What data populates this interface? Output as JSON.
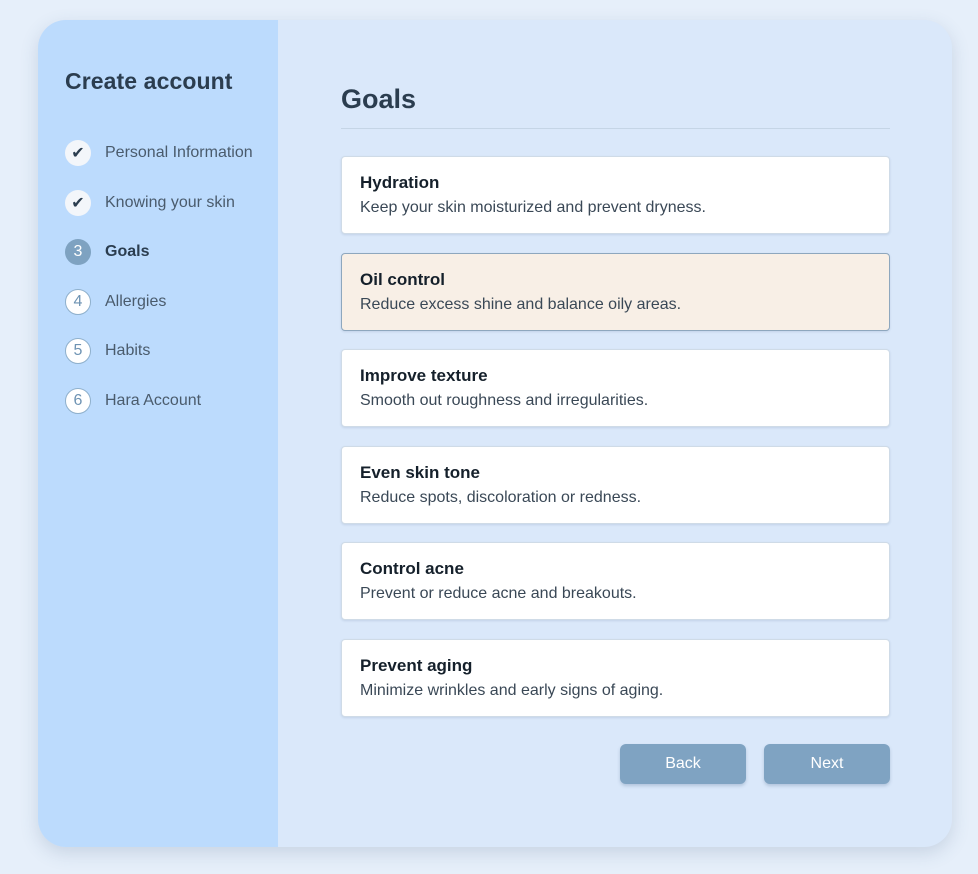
{
  "sidebar": {
    "title": "Create account",
    "steps": [
      {
        "marker": "✔",
        "label": "Personal Information",
        "state": "done"
      },
      {
        "marker": "✔",
        "label": "Knowing your skin",
        "state": "done"
      },
      {
        "marker": "3",
        "label": "Goals",
        "state": "current"
      },
      {
        "marker": "4",
        "label": "Allergies",
        "state": "upcoming"
      },
      {
        "marker": "5",
        "label": "Habits",
        "state": "upcoming"
      },
      {
        "marker": "6",
        "label": "Hara Account",
        "state": "upcoming"
      }
    ]
  },
  "main": {
    "title": "Goals",
    "goals": [
      {
        "title": "Hydration",
        "description": "Keep your skin moisturized and prevent dryness.",
        "selected": false
      },
      {
        "title": "Oil control",
        "description": "Reduce excess shine and balance oily areas.",
        "selected": true
      },
      {
        "title": "Improve texture",
        "description": "Smooth out roughness and irregularities.",
        "selected": false
      },
      {
        "title": "Even skin tone",
        "description": "Reduce spots, discoloration or redness.",
        "selected": false
      },
      {
        "title": "Control acne",
        "description": "Prevent or reduce acne and breakouts.",
        "selected": false
      },
      {
        "title": "Prevent aging",
        "description": "Minimize wrinkles and early signs of aging.",
        "selected": false
      }
    ],
    "back_label": "Back",
    "next_label": "Next"
  },
  "colors": {
    "page_bg": "#e6effa",
    "sidebar_bg": "#bcdbfd",
    "main_bg": "#dae8fa",
    "accent": "#7fa3c2",
    "selected_card_bg": "#f8efe6",
    "heading": "#2b3d4f"
  }
}
